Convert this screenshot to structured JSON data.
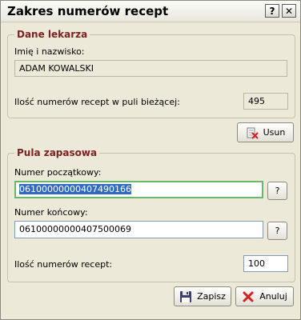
{
  "window": {
    "title": "Zakres numerów recept",
    "help_glyph": "?",
    "close_glyph": "✕"
  },
  "doctor": {
    "legend": "Dane lekarza",
    "name_label": "Imię i nazwisko:",
    "name_value": "ADAM KOWALSKI",
    "pool_count_label": "Ilość numerów recept w puli bieżącej:",
    "pool_count_value": "495"
  },
  "delete_button": {
    "label": "Usun",
    "icon": "delete-list-icon"
  },
  "reserve": {
    "legend": "Pula zapasowa",
    "start_label": "Numer początkowy:",
    "start_value": "06100000000407490166",
    "end_label": "Numer końcowy:",
    "end_value": "06100000000407500069",
    "help_label": "?",
    "count_label": "Ilość numerów recept:",
    "count_value": "100"
  },
  "footer": {
    "save_label": "Zapisz",
    "cancel_label": "Anuluj",
    "save_icon": "floppy-disk-icon",
    "cancel_icon": "red-x-icon"
  },
  "colors": {
    "legend": "#7b2222",
    "selection": "#316ac5",
    "focus_border": "#6ab86a",
    "cancel_x": "#d42020"
  }
}
